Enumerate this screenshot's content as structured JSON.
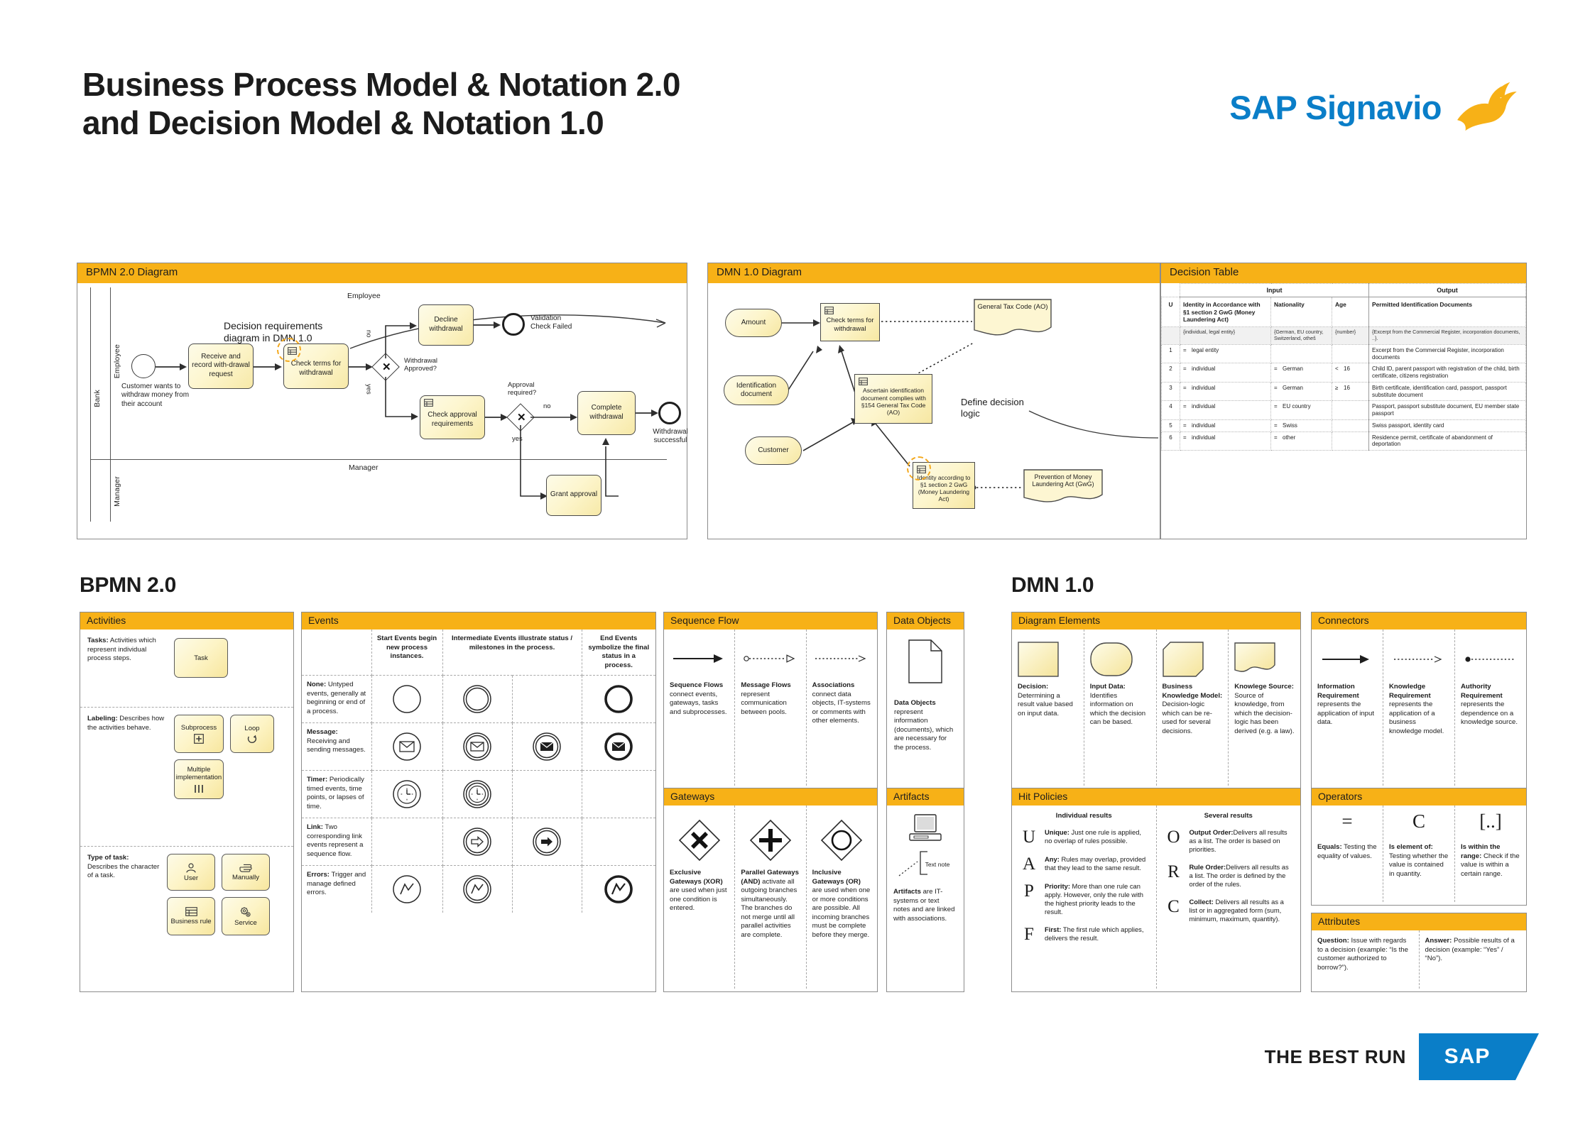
{
  "header": {
    "title_line1": "Business Process Model & Notation 2.0",
    "title_line2": "and Decision Model & Notation 1.0",
    "brand": "SAP Signavio"
  },
  "bpmn_diagram": {
    "panel_title": "BPMN 2.0 Diagram",
    "pool_label": "Bank",
    "lane_employee_side": "Employee",
    "lane_employee_top": "Employee",
    "lane_manager_side": "Manager",
    "lane_manager_top": "Manager",
    "annotation": "Decision requirements diagram in DMN 1.0",
    "start_event_label": "Customer wants to withdraw money from their account",
    "tasks": {
      "receive": "Receive and record with-drawal request",
      "check_terms": "Check terms for withdrawal",
      "decline": "Decline withdrawal",
      "check_approval": "Check approval requirements",
      "complete": "Complete withdrawal",
      "grant": "Grant approval"
    },
    "gateways": {
      "withdrawal_approved": "Withdrawal Approved?",
      "approval_required": "Approval required?"
    },
    "flow_labels": {
      "no1": "no",
      "yes1": "yes",
      "no2": "no",
      "yes2": "yes"
    },
    "end_events": {
      "validation_failed": "Validation Check Failed",
      "withdrawal_successful": "Withdrawal successful"
    }
  },
  "dmn_diagram": {
    "panel_title": "DMN 1.0 Diagram",
    "annotation": "Define decision logic",
    "nodes": {
      "amount": "Amount",
      "identification_document": "Identification document",
      "customer": "Customer",
      "check_terms": "Check terms for withdrawal",
      "ascertain": "Ascertain identification document complies with §154 General Tax Code (AO)",
      "identity": "Identity according to §1 section 2 GwG (Money Laundering Act)",
      "general_tax_code": "General Tax Code (AO)",
      "prevention": "Prevention of Money Laundering Act (GwG)"
    }
  },
  "decision_table": {
    "panel_title": "Decision Table",
    "group_input": "Input",
    "group_output": "Output",
    "hit_policy": "U",
    "headers": [
      "Identity in Accordance with §1 section 2 GwG (Money Laundering Act)",
      "Nationality",
      "Age",
      "Permitted Identification Documents"
    ],
    "types": [
      "{individual, legal entity}",
      "{German, EU country, Switzerland, otheš",
      "{number}",
      "{Excerpt from the Commercial Register, incorporation documents, ..}."
    ],
    "rows": [
      {
        "n": "1",
        "identity_op": "=",
        "identity": "legal entity",
        "nat_op": "",
        "nationality": "",
        "age_op": "",
        "age": "",
        "output": "Excerpt from the Commercial Register, incorporation documents"
      },
      {
        "n": "2",
        "identity_op": "=",
        "identity": "individual",
        "nat_op": "=",
        "nationality": "German",
        "age_op": "<",
        "age": "16",
        "output": "Child ID, parent passport with registration of the child, birth certificate, citizens registration"
      },
      {
        "n": "3",
        "identity_op": "=",
        "identity": "individual",
        "nat_op": "=",
        "nationality": "German",
        "age_op": "≥",
        "age": "16",
        "output": "Birth certificate, identification card, passport, passport substitute document"
      },
      {
        "n": "4",
        "identity_op": "=",
        "identity": "individual",
        "nat_op": "=",
        "nationality": "EU country",
        "age_op": "",
        "age": "",
        "output": "Passport, passport substitute document, EU member state passport"
      },
      {
        "n": "5",
        "identity_op": "=",
        "identity": "individual",
        "nat_op": "=",
        "nationality": "Swiss",
        "age_op": "",
        "age": "",
        "output": "Swiss passport, identity card"
      },
      {
        "n": "6",
        "identity_op": "=",
        "identity": "individual",
        "nat_op": "=",
        "nationality": "other",
        "age_op": "",
        "age": "",
        "output": "Residence permit, certificate of abandonment of deportation"
      }
    ]
  },
  "sections": {
    "bpmn": "BPMN 2.0",
    "dmn": "DMN 1.0"
  },
  "activities": {
    "panel_title": "Activities",
    "groups": [
      {
        "lead": "Tasks:",
        "text": " Activities which represent individual process steps.",
        "shapes": [
          "Task"
        ]
      },
      {
        "lead": "Labeling:",
        "text": " Describes how the activities behave.",
        "shapes": [
          "Subprocess",
          "Loop",
          "Multiple implementation"
        ]
      },
      {
        "lead": "Type of task:",
        "text": " Describes the character of a task.",
        "shapes": [
          "User",
          "Manually",
          "Business rule",
          "Service"
        ]
      }
    ]
  },
  "events": {
    "panel_title": "Events",
    "columns": [
      {
        "lead": "Start Events",
        "text": " begin new process instances."
      },
      {
        "lead": "Intermediate Events",
        "text": " illustrate status / milestones in the process."
      },
      {
        "lead": "End Events",
        "text": " symbolize the final status in a process."
      }
    ],
    "rows": [
      {
        "lead": "None:",
        "text": " Untyped events, generally at beginning or end of a process."
      },
      {
        "lead": "Message:",
        "text": " Receiving and sending messages."
      },
      {
        "lead": "Timer:",
        "text": " Periodically timed events, time points, or lapses of time."
      },
      {
        "lead": "Link:",
        "text": " Two corresponding link events represent a sequence flow."
      },
      {
        "lead": "Errors:",
        "text": " Trigger and manage defined errors."
      }
    ]
  },
  "sequence_flow": {
    "panel_title": "Sequence Flow",
    "items": [
      {
        "lead": "Sequence Flows",
        "text": " connect events, gateways, tasks and subprocesses."
      },
      {
        "lead": "Message Flows",
        "text": " represent communication between pools."
      },
      {
        "lead": "Associations",
        "text": " connect data objects, IT-systems or comments with other elements."
      }
    ]
  },
  "data_objects": {
    "panel_title": "Data Objects",
    "lead": "Data Objects",
    "text": " represent information (documents), which are necessary for the process."
  },
  "gateways": {
    "panel_title": "Gateways",
    "items": [
      {
        "lead": "Exclusive Gateways (XOR)",
        "text": " are used when just one condition is entered."
      },
      {
        "lead": "Parallel Gateways (AND)",
        "text": " activate all outgoing branches simultaneously. The branches do not merge until all parallel activities are complete."
      },
      {
        "lead": "Inclusive Gateways (OR)",
        "text": " are used when one or more conditions are possible. All incoming branches must be complete before they merge."
      }
    ]
  },
  "artifacts": {
    "panel_title": "Artifacts",
    "note_label": "Text note",
    "lead": "Artifacts",
    "text": " are IT-systems or text notes and are linked with associations."
  },
  "diagram_elements": {
    "panel_title": "Diagram Elements",
    "items": [
      {
        "lead": "Decision:",
        "text": " Determining a result value based on input data."
      },
      {
        "lead": "Input Data:",
        "text": " Identifies information on which the decision can be based."
      },
      {
        "lead": "Business Knowledge Model:",
        "text": " Decision-logic which can be re-used for several decisions."
      },
      {
        "lead": "Knowlege Source:",
        "text": " Source of knowledge, from which the decision-logic has been derived (e.g. a law)."
      }
    ]
  },
  "connectors": {
    "panel_title": "Connectors",
    "items": [
      {
        "lead": "Information Requirement",
        "text": " represents the application of input data."
      },
      {
        "lead": "Knowledge Requirement",
        "text": " represents the application of a business knowledge model."
      },
      {
        "lead": "Authority Requirement",
        "text": " represents the dependence on a knowledge source."
      }
    ]
  },
  "hit_policies": {
    "panel_title": "Hit Policies",
    "col1_title": "Individual results",
    "col2_title": "Several results",
    "individual": [
      {
        "letter": "U",
        "lead": "Unique:",
        "text": " Just one rule is applied, no overlap of rules possible."
      },
      {
        "letter": "A",
        "lead": "Any:",
        "text": " Rules may overlap, provided that they lead to the same result."
      },
      {
        "letter": "P",
        "lead": "Priority:",
        "text": " More than one rule can apply. However, only the rule with the highest priority leads to the result."
      },
      {
        "letter": "F",
        "lead": "First:",
        "text": " The first rule which applies, delivers the result."
      }
    ],
    "several": [
      {
        "letter": "O",
        "lead": "Output Order:",
        "text": "Delivers all results as a list. The order is based on priorities."
      },
      {
        "letter": "R",
        "lead": "Rule Order:",
        "text": "Delivers all results as a list. The order is defined by the order of the rules."
      },
      {
        "letter": "C",
        "lead": "Collect:",
        "text": " Delivers all results as a list or in aggregated form (sum, minimum, maximum, quantity)."
      }
    ]
  },
  "operators": {
    "panel_title": "Operators",
    "items": [
      {
        "symbol": "=",
        "lead": "Equals:",
        "text": " Testing the equality of values."
      },
      {
        "symbol": "C",
        "lead": "Is element of:",
        "text": " Testing whether the value is contained in quantity."
      },
      {
        "symbol": "[..]",
        "lead": "Is within the range:",
        "text": " Check if the value is within a certain range."
      }
    ]
  },
  "attributes": {
    "panel_title": "Attributes",
    "items": [
      {
        "lead": "Question:",
        "text": " Issue with regards to a decision (example: “Is the customer authorized to borrow?”)."
      },
      {
        "lead": "Answer:",
        "text": " Possible results of a decision (example: “Yes” / “No”)."
      }
    ]
  },
  "footer": {
    "tagline": "THE BEST RUN",
    "logo": "SAP"
  },
  "colors": {
    "accent": "#f7b117",
    "brand_blue": "#0a7ec8",
    "shape_fill": "#fdf4c6"
  }
}
